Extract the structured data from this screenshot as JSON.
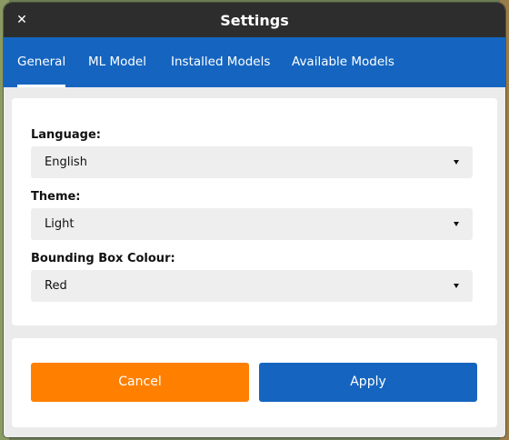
{
  "window": {
    "title": "Settings",
    "close_glyph": "✕"
  },
  "tabs": [
    {
      "label": "General",
      "active": true
    },
    {
      "label": "ML Model",
      "active": false
    },
    {
      "label": "Installed Models",
      "active": false
    },
    {
      "label": "Available Models",
      "active": false
    }
  ],
  "settings": {
    "language": {
      "label": "Language:",
      "value": "English"
    },
    "theme": {
      "label": "Theme:",
      "value": "Light"
    },
    "bbox_colour": {
      "label": "Bounding Box Colour:",
      "value": "Red"
    }
  },
  "actions": {
    "cancel_label": "Cancel",
    "apply_label": "Apply"
  },
  "colors": {
    "titlebar": "#2d2d2d",
    "tabbar": "#1565c0",
    "cancel": "#ff8000",
    "apply": "#1565c0",
    "dialog_bg": "#ebebeb"
  },
  "icons": {
    "close": "close-icon",
    "dropdown": "chevron-down-icon"
  }
}
